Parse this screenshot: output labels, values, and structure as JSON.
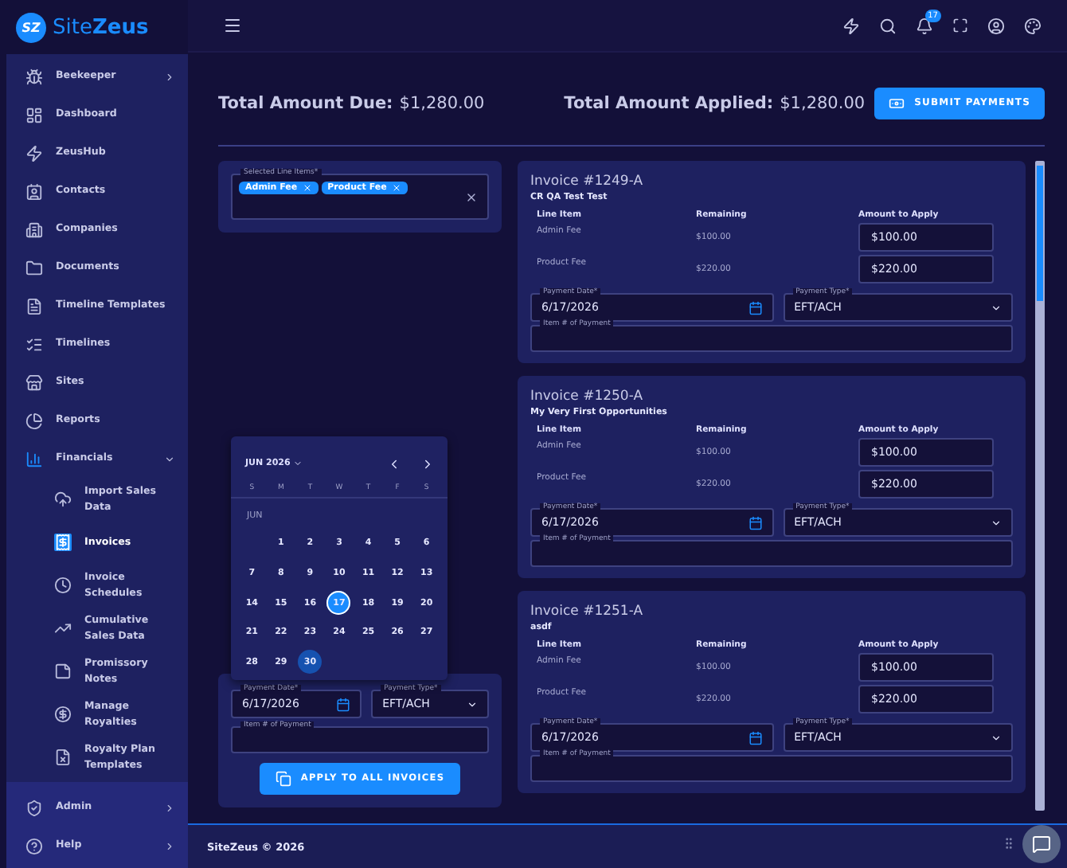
{
  "logo": {
    "mark": "SZ",
    "name": "Site**Zeus**"
  },
  "sidebar": {
    "items": [
      {
        "label": "Beekeeper",
        "expanded": false
      },
      {
        "label": "Dashboard"
      },
      {
        "label": "ZeusHub"
      },
      {
        "label": "Contacts"
      },
      {
        "label": "Companies"
      },
      {
        "label": "Documents"
      },
      {
        "label": "Timeline Templates"
      },
      {
        "label": "Timelines"
      },
      {
        "label": "Sites"
      },
      {
        "label": "Reports"
      },
      {
        "label": "Financials",
        "expanded": true,
        "children": [
          {
            "label": "Import Sales Data",
            "selected": false
          },
          {
            "label": "Invoices",
            "selected": true
          },
          {
            "label": "Invoice Schedules",
            "selected": false
          },
          {
            "label": "Cumulative Sales Data",
            "selected": false
          },
          {
            "label": "Promissory Notes",
            "selected": false
          },
          {
            "label": "Manage Royalties",
            "selected": false
          },
          {
            "label": "Royalty Plan Templates",
            "selected": false
          }
        ]
      }
    ],
    "footer_items": [
      {
        "label": "Admin",
        "expanded": false
      },
      {
        "label": "Help",
        "expanded": false
      }
    ]
  },
  "header": {
    "notifications": "17"
  },
  "totals": {
    "due_label": "Total Amount Due:",
    "due_value": "$1,280.00",
    "applied_label": "Total Amount Applied:",
    "applied_value": "$1,280.00",
    "submit": "SUBMIT PAYMENTS"
  },
  "selection": {
    "label": "Selected Line Items*",
    "chips": [
      "Admin Fee",
      "Product Fee"
    ]
  },
  "bulk": {
    "payment_date": {
      "label": "Payment Date*",
      "value": "6/17/2026"
    },
    "payment_type": {
      "label": "Payment Type*",
      "value": "EFT/ACH"
    },
    "item_number": {
      "label": "Item # of Payment"
    },
    "apply": "APPLY TO ALL INVOICES"
  },
  "calendar": {
    "month": "JUN 2026",
    "weekdays": [
      "S",
      "M",
      "T",
      "W",
      "T",
      "F",
      "S"
    ],
    "section": "JUN",
    "weeks": [
      [
        {
          "label": "1",
          "selected": false,
          "today": false
        },
        {
          "label": "2",
          "selected": false,
          "today": false
        },
        {
          "label": "3",
          "selected": false,
          "today": false
        },
        {
          "label": "4",
          "selected": false,
          "today": false
        },
        {
          "label": "5",
          "selected": false,
          "today": false
        },
        {
          "label": "6",
          "selected": false,
          "today": false
        }
      ],
      [
        {
          "label": "7",
          "selected": false,
          "today": false
        },
        {
          "label": "8",
          "selected": false,
          "today": false
        },
        {
          "label": "9",
          "selected": false,
          "today": false
        },
        {
          "label": "10",
          "selected": false,
          "today": false
        },
        {
          "label": "11",
          "selected": false,
          "today": false
        },
        {
          "label": "12",
          "selected": false,
          "today": false
        },
        {
          "label": "13",
          "selected": false,
          "today": false
        }
      ],
      [
        {
          "label": "14",
          "selected": false,
          "today": false
        },
        {
          "label": "15",
          "selected": false,
          "today": false
        },
        {
          "label": "16",
          "selected": false,
          "today": false
        },
        {
          "label": "17",
          "selected": true,
          "today": false
        },
        {
          "label": "18",
          "selected": false,
          "today": false
        },
        {
          "label": "19",
          "selected": false,
          "today": false
        },
        {
          "label": "20",
          "selected": false,
          "today": false
        }
      ],
      [
        {
          "label": "21",
          "selected": false,
          "today": false
        },
        {
          "label": "22",
          "selected": false,
          "today": false
        },
        {
          "label": "23",
          "selected": false,
          "today": false
        },
        {
          "label": "24",
          "selected": false,
          "today": false
        },
        {
          "label": "25",
          "selected": false,
          "today": false
        },
        {
          "label": "26",
          "selected": false,
          "today": false
        },
        {
          "label": "27",
          "selected": false,
          "today": false
        }
      ],
      [
        {
          "label": "28",
          "selected": false,
          "today": false
        },
        {
          "label": "29",
          "selected": false,
          "today": false
        },
        {
          "label": "30",
          "selected": false,
          "today": true
        }
      ]
    ]
  },
  "invoices": [
    {
      "title": "Invoice #1249-A",
      "subtitle": "CR QA Test Test",
      "columns": [
        "Line Item",
        "Remaining",
        "Amount to Apply"
      ],
      "lines": [
        {
          "name": "Admin Fee",
          "remaining": "$100.00",
          "amount": "$100.00"
        },
        {
          "name": "Product Fee",
          "remaining": "$220.00",
          "amount": "$220.00"
        }
      ],
      "payment_date": {
        "label": "Payment Date*",
        "value": "6/17/2026"
      },
      "payment_type": {
        "label": "Payment Type*",
        "value": "EFT/ACH"
      },
      "item_number": {
        "label": "Item # of Payment"
      }
    },
    {
      "title": "Invoice #1250-A",
      "subtitle": "My Very First Opportunities",
      "columns": [
        "Line Item",
        "Remaining",
        "Amount to Apply"
      ],
      "lines": [
        {
          "name": "Admin Fee",
          "remaining": "$100.00",
          "amount": "$100.00"
        },
        {
          "name": "Product Fee",
          "remaining": "$220.00",
          "amount": "$220.00"
        }
      ],
      "payment_date": {
        "label": "Payment Date*",
        "value": "6/17/2026"
      },
      "payment_type": {
        "label": "Payment Type*",
        "value": "EFT/ACH"
      },
      "item_number": {
        "label": "Item # of Payment"
      }
    },
    {
      "title": "Invoice #1251-A",
      "subtitle": "asdf",
      "columns": [
        "Line Item",
        "Remaining",
        "Amount to Apply"
      ],
      "lines": [
        {
          "name": "Admin Fee",
          "remaining": "$100.00",
          "amount": "$100.00"
        },
        {
          "name": "Product Fee",
          "remaining": "$220.00",
          "amount": "$220.00"
        }
      ],
      "payment_date": {
        "label": "Payment Date*",
        "value": "6/17/2026"
      },
      "payment_type": {
        "label": "Payment Type*",
        "value": "EFT/ACH"
      },
      "item_number": {
        "label": "Item # of Payment"
      }
    }
  ],
  "footer": {
    "text": "SiteZeus © 2026"
  }
}
